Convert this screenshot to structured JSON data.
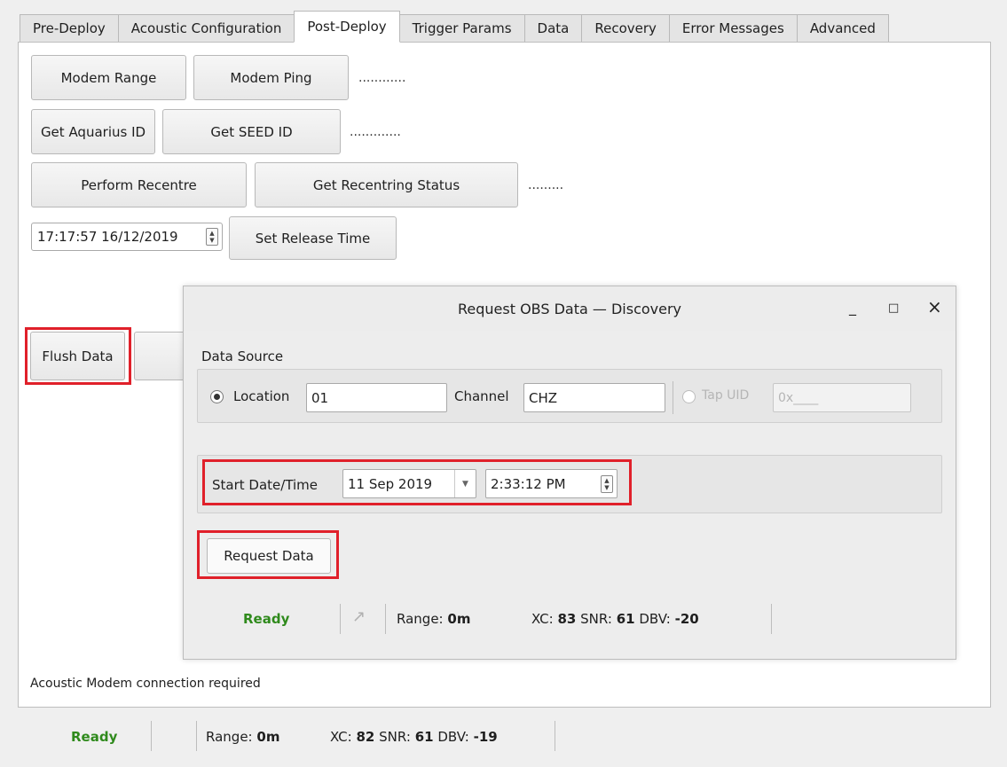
{
  "tabs": [
    "Pre-Deploy",
    "Acoustic Configuration",
    "Post-Deploy",
    "Trigger Params",
    "Data",
    "Recovery",
    "Error Messages",
    "Advanced"
  ],
  "active_tab": "Post-Deploy",
  "post_deploy": {
    "modem_range_label": "Modem Range",
    "modem_ping_label": "Modem Ping",
    "modem_result": "............",
    "get_aquarius_id_label": "Get Aquarius ID",
    "get_seed_id_label": "Get SEED ID",
    "id_result": ".............",
    "perform_recentre_label": "Perform Recentre",
    "get_recentring_status_label": "Get Recentring Status",
    "recentre_result": ".........",
    "release_datetime": "17:17:57 16/12/2019",
    "set_release_time_label": "Set Release Time",
    "flush_data_label": "Flush Data",
    "footer_message": "Acoustic Modem connection required"
  },
  "dialog": {
    "title": "Request OBS Data — Discovery",
    "minimize_icon": "_",
    "maximize_icon": "□",
    "close_icon": "×",
    "data_source_label": "Data Source",
    "location_label": "Location",
    "location_value": "01",
    "channel_label": "Channel",
    "channel_value": "CHZ",
    "tap_uid_label": "Tap UID",
    "tap_uid_placeholder": "0x____",
    "start_datetime_label": "Start Date/Time",
    "start_date": "11 Sep 2019",
    "start_time": "2:33:12 PM",
    "request_data_label": "Request Data",
    "status": {
      "ready": "Ready",
      "range_label": "Range:",
      "range_value": "0m",
      "xc_label": "XC:",
      "xc_value": "83",
      "snr_label": "SNR:",
      "snr_value": "61",
      "dbv_label": "DBV:",
      "dbv_value": "-20"
    }
  },
  "main_status": {
    "ready": "Ready",
    "range_label": "Range:",
    "range_value": "0m",
    "xc_label": "XC:",
    "xc_value": "82",
    "snr_label": "SNR:",
    "snr_value": "61",
    "dbv_label": "DBV:",
    "dbv_value": "-19"
  },
  "colors": {
    "highlight": "#e0202a",
    "ready_green": "#2f8a1c"
  }
}
